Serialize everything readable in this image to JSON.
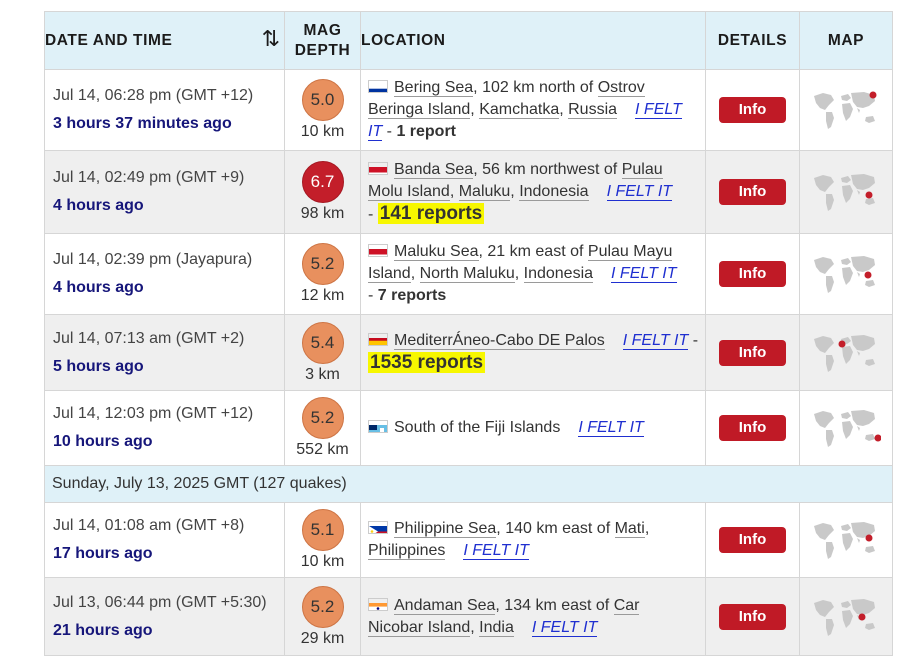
{
  "header": {
    "date_time": "DATE AND TIME",
    "sort_icon": "⇅",
    "mag": "MAG",
    "depth": "DEPTH",
    "location": "LOCATION",
    "details": "DETAILS",
    "map": "MAP"
  },
  "info_label": "Info",
  "felt_label": "I FELT IT",
  "colors": {
    "mag_orange": "#e8905e",
    "mag_red": "#c31e2a",
    "info_button": "#c01a26",
    "header_bg": "#dff1f8",
    "alt_row": "#efefef"
  },
  "quakes": [
    {
      "time": "Jul 14, 06:28 pm (GMT +12)",
      "ago": "3 hours 37 minutes ago",
      "mag": "5.0",
      "mag_level": "orange",
      "depth": "10 km",
      "flag": "russia-flag-icon",
      "loc_a": "Bering Sea",
      "loc_b": ", 102 km north of ",
      "loc_c": "Ostrov Beringa Island",
      "loc_d": ", ",
      "loc_e": "Kamchatka",
      "loc_f": ", ",
      "loc_g": "Russia",
      "sep": " - ",
      "reports": "1 report"
    },
    {
      "time": "Jul 14, 02:49 pm (GMT +9)",
      "ago": "4 hours ago",
      "mag": "6.7",
      "mag_level": "red",
      "depth": "98 km",
      "flag": "indonesia-flag-icon",
      "loc_a": "Banda Sea",
      "loc_b": ", 56 km northwest of ",
      "loc_c": "Pulau Molu Island",
      "loc_d": ", ",
      "loc_e": "Maluku",
      "loc_f": ", ",
      "loc_g": "Indonesia",
      "sep": " - ",
      "reports": "141 reports"
    },
    {
      "time": "Jul 14, 02:39 pm (Jayapura)",
      "ago": "4 hours ago",
      "mag": "5.2",
      "mag_level": "orange",
      "depth": "12 km",
      "flag": "indonesia-flag-icon",
      "loc_a": "Maluku Sea",
      "loc_b": ", 21 km east of ",
      "loc_c": "Pulau Mayu Island",
      "loc_d": ", ",
      "loc_e": "North Maluku",
      "loc_f": ", ",
      "loc_g": "Indonesia",
      "sep": " - ",
      "reports": "7 reports"
    },
    {
      "time": "Jul 14, 07:13 am (GMT +2)",
      "ago": "5 hours ago",
      "mag": "5.4",
      "mag_level": "orange",
      "depth": "3 km",
      "flag": "spain-flag-icon",
      "loc_a": "MediterrÁneo-Cabo DE Palos",
      "sep": " - ",
      "reports": "1535 reports"
    },
    {
      "time": "Jul 14, 12:03 pm (GMT +12)",
      "ago": "10 hours ago",
      "mag": "5.2",
      "mag_level": "orange",
      "depth": "552 km",
      "flag": "fiji-flag-icon",
      "loc_a": "South of the Fiji Islands"
    },
    {
      "time": "Jul 14, 01:08 am (GMT +8)",
      "ago": "17 hours ago",
      "mag": "5.1",
      "mag_level": "orange",
      "depth": "10 km",
      "flag": "philippines-flag-icon",
      "loc_a": "Philippine Sea",
      "loc_b": ", 140 km east of ",
      "loc_c": "Mati",
      "loc_d": ", ",
      "loc_e": "Philippines"
    },
    {
      "time": "Jul 13, 06:44 pm (GMT +5:30)",
      "ago": "21 hours ago",
      "mag": "5.2",
      "mag_level": "orange",
      "depth": "29 km",
      "flag": "india-flag-icon",
      "loc_a": "Andaman Sea",
      "loc_b": ", 134 km east of ",
      "loc_c": "Car Nicobar Island",
      "loc_d": ", ",
      "loc_e": "India"
    }
  ],
  "day_divider": "Sunday, July 13, 2025 GMT (127 quakes)"
}
